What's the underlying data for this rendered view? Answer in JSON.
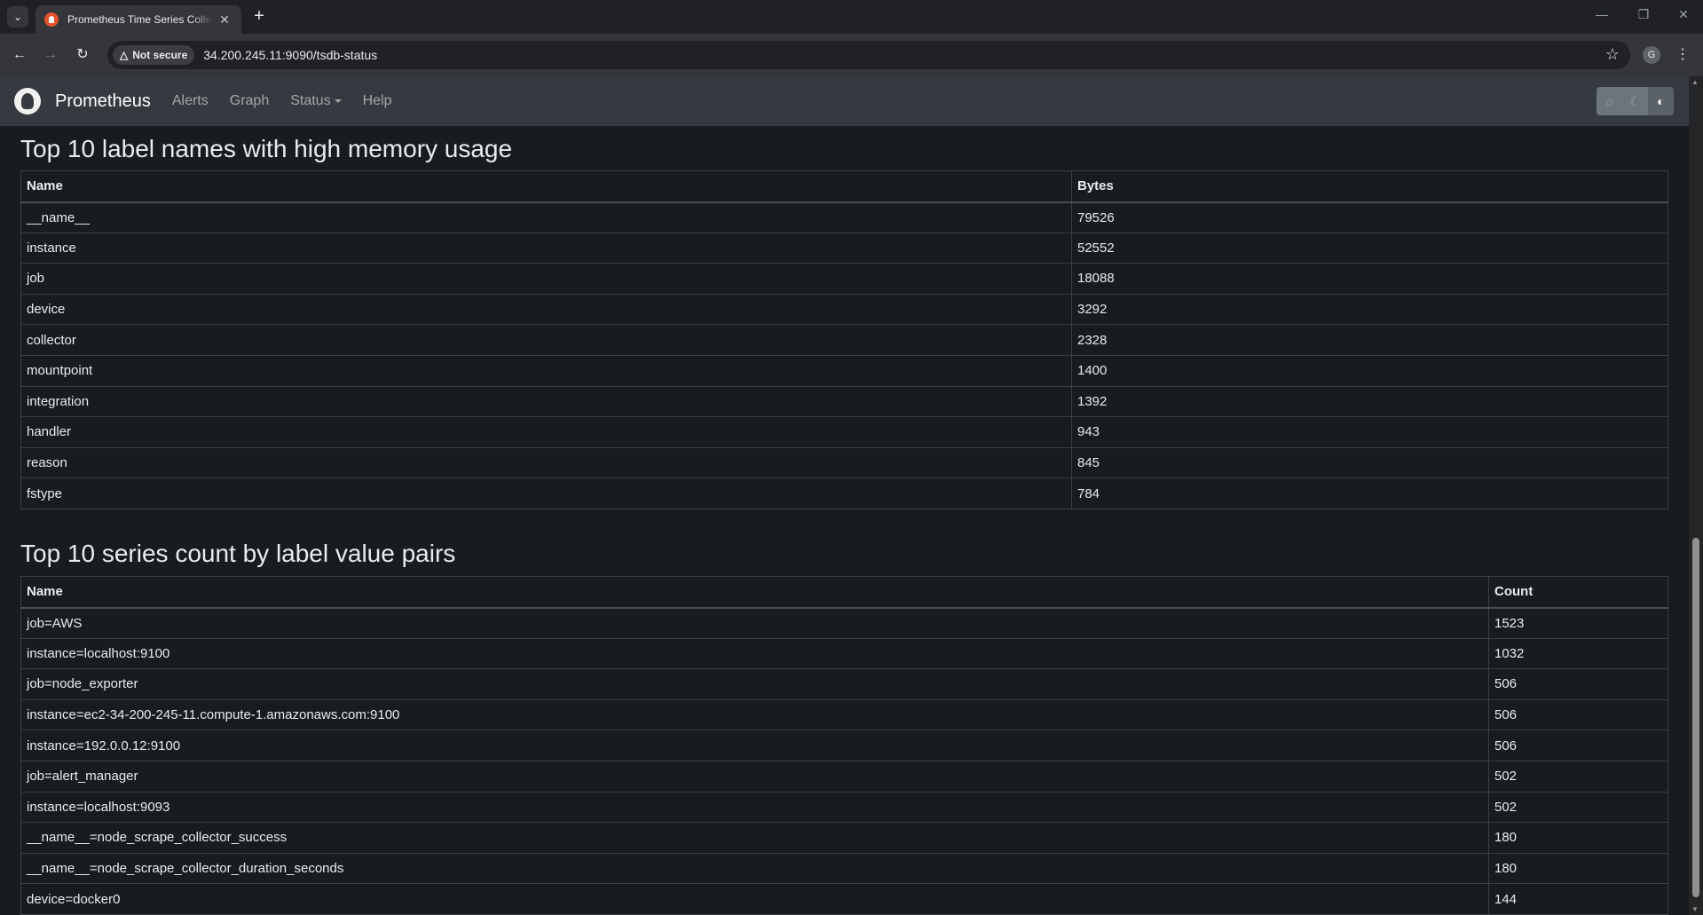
{
  "browser": {
    "tab_title": "Prometheus Time Series Collection and Processing Server",
    "security_label": "Not secure",
    "url": "34.200.245.11:9090/tsdb-status",
    "profile_initial": "G"
  },
  "navbar": {
    "brand": "Prometheus",
    "links": [
      "Alerts",
      "Graph",
      "Status",
      "Help"
    ]
  },
  "memory_section": {
    "title": "Top 10 label names with high memory usage",
    "headers": [
      "Name",
      "Bytes"
    ],
    "rows": [
      [
        "__name__",
        "79526"
      ],
      [
        "instance",
        "52552"
      ],
      [
        "job",
        "18088"
      ],
      [
        "device",
        "3292"
      ],
      [
        "collector",
        "2328"
      ],
      [
        "mountpoint",
        "1400"
      ],
      [
        "integration",
        "1392"
      ],
      [
        "handler",
        "943"
      ],
      [
        "reason",
        "845"
      ],
      [
        "fstype",
        "784"
      ]
    ]
  },
  "series_section": {
    "title": "Top 10 series count by label value pairs",
    "headers": [
      "Name",
      "Count"
    ],
    "rows": [
      [
        "job=AWS",
        "1523"
      ],
      [
        "instance=localhost:9100",
        "1032"
      ],
      [
        "job=node_exporter",
        "506"
      ],
      [
        "instance=ec2-34-200-245-11.compute-1.amazonaws.com:9100",
        "506"
      ],
      [
        "instance=192.0.0.12:9100",
        "506"
      ],
      [
        "job=alert_manager",
        "502"
      ],
      [
        "instance=localhost:9093",
        "502"
      ],
      [
        "__name__=node_scrape_collector_success",
        "180"
      ],
      [
        "__name__=node_scrape_collector_duration_seconds",
        "180"
      ],
      [
        "device=docker0",
        "144"
      ]
    ]
  }
}
